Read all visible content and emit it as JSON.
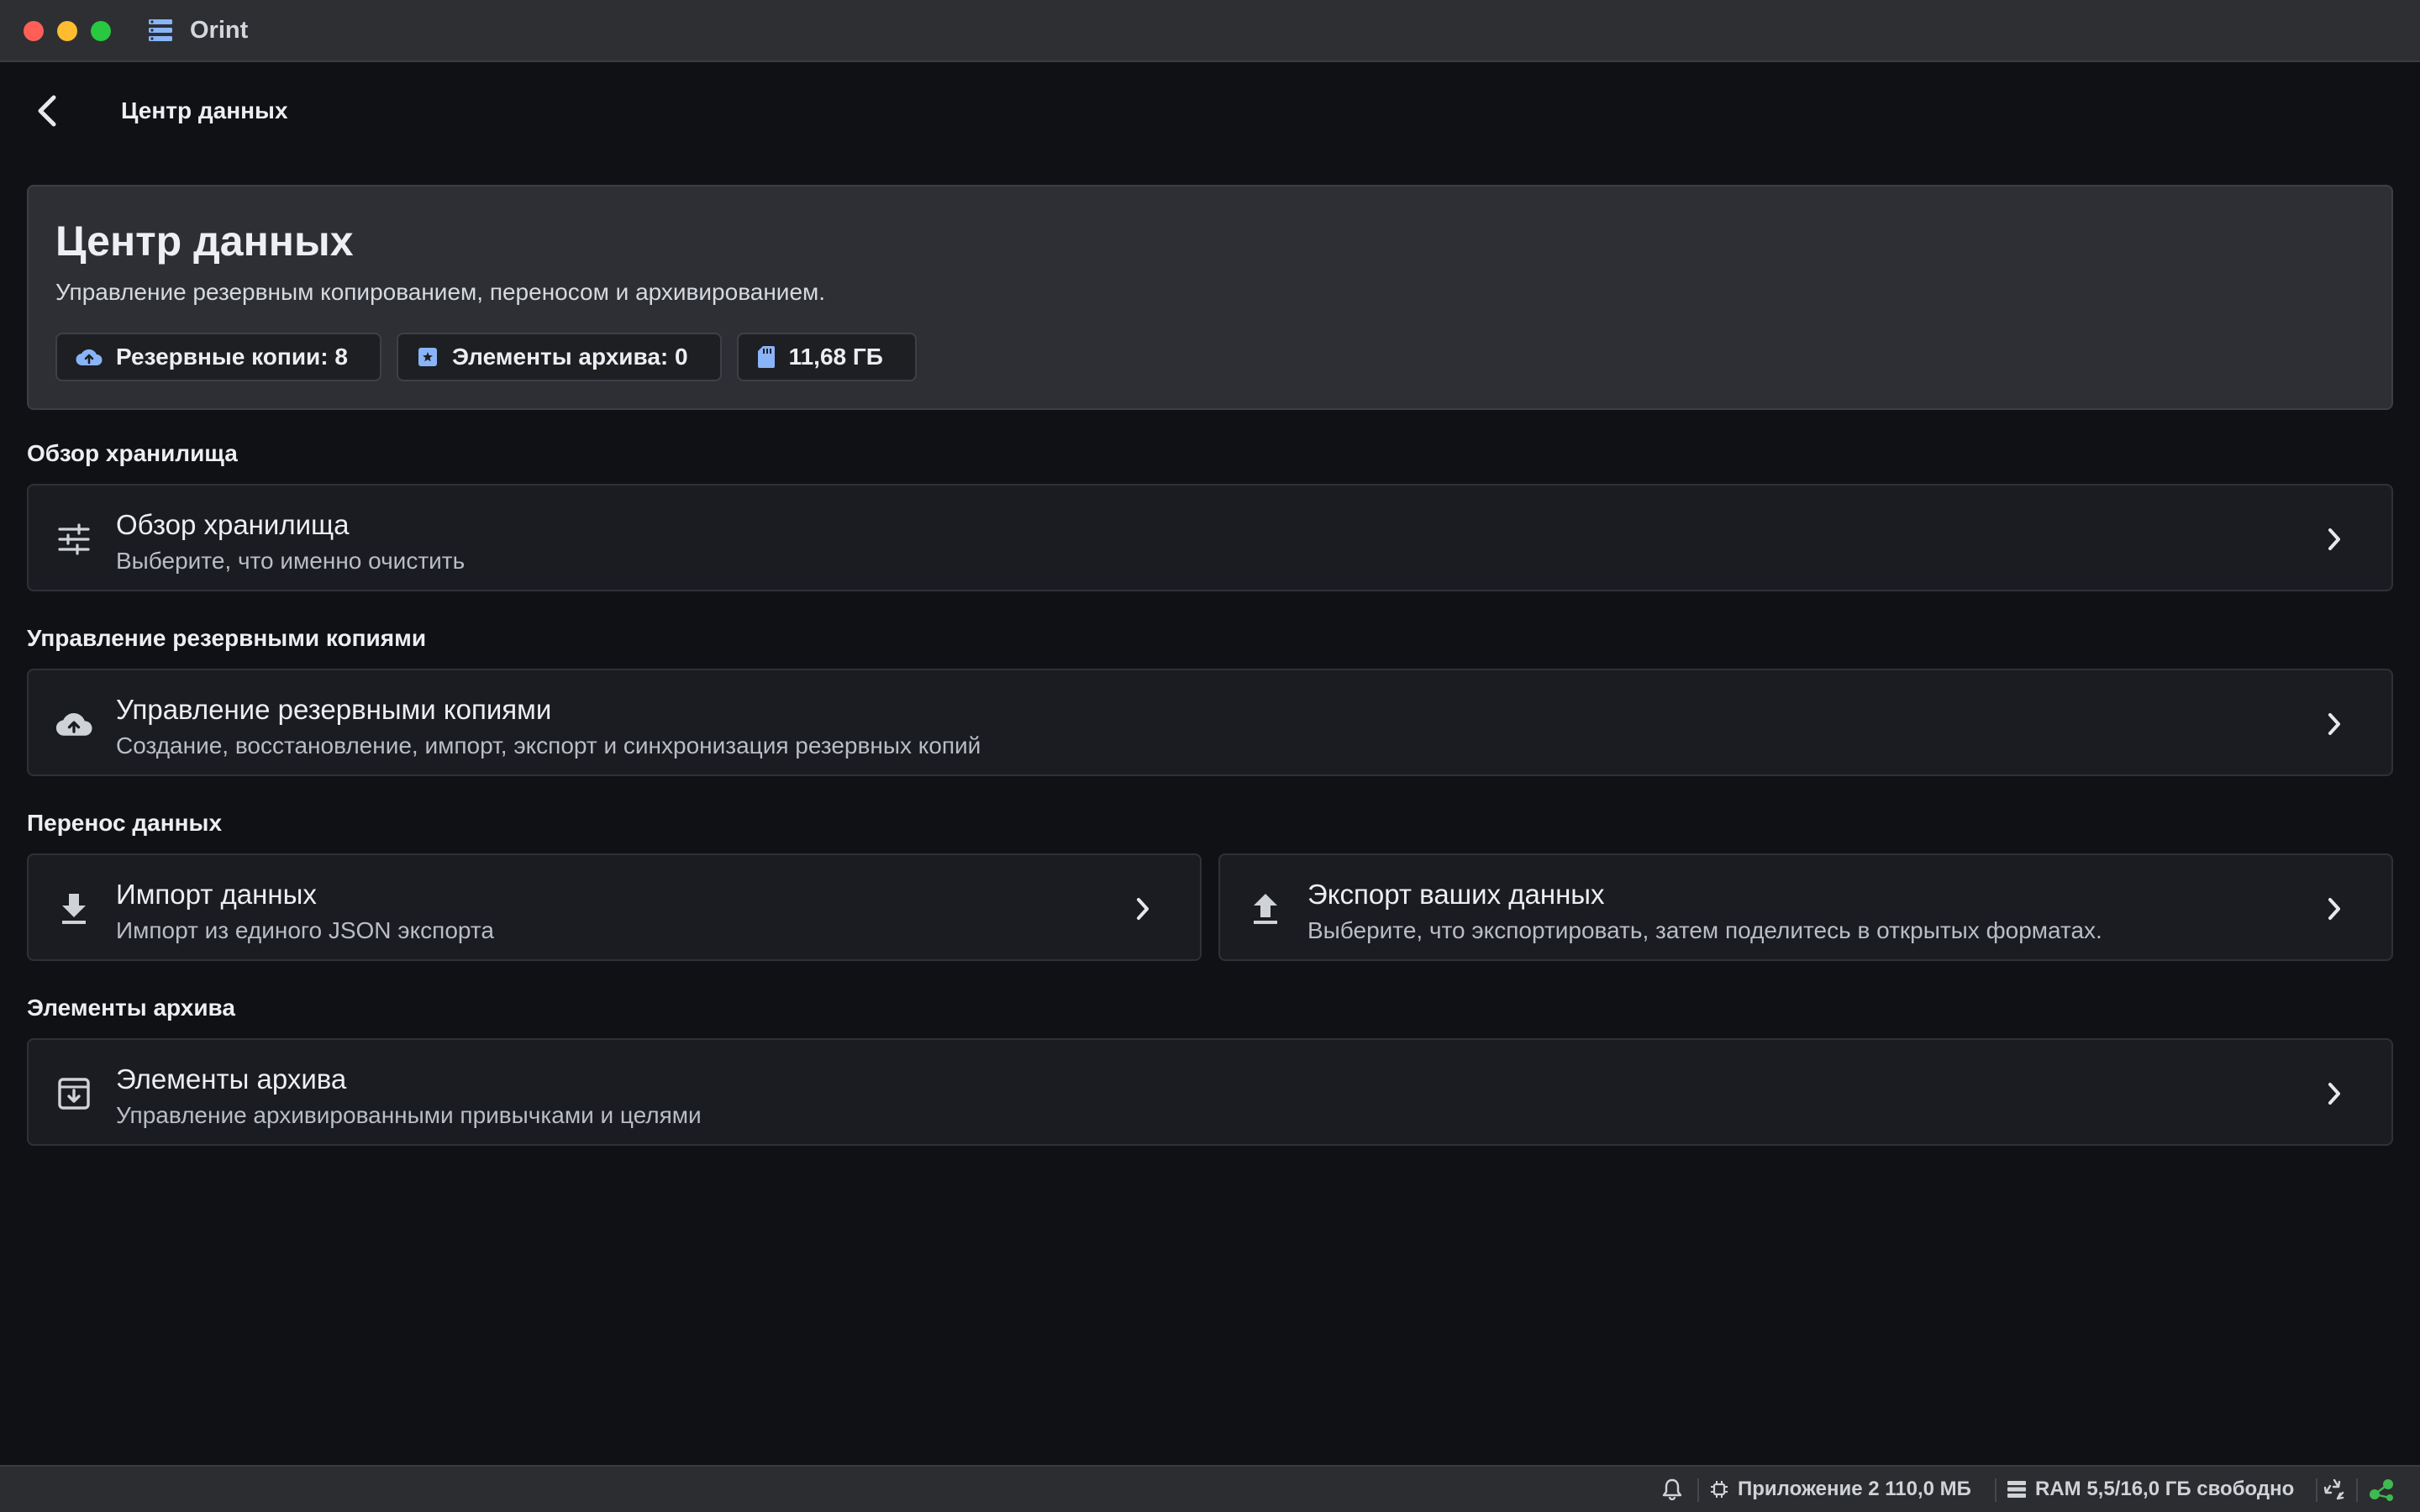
{
  "window": {
    "app_title": "Orint"
  },
  "header": {
    "title": "Центр данных"
  },
  "hero": {
    "title": "Центр данных",
    "subtitle": "Управление резервным копированием, переносом и архивированием.",
    "chips": [
      {
        "icon": "cloud-upload-icon",
        "label": "Резервные копии: 8"
      },
      {
        "icon": "archive-box-icon",
        "label": "Элементы архива: 0"
      },
      {
        "icon": "sd-card-icon",
        "label": "11,68 ГБ"
      }
    ]
  },
  "sections": {
    "storage": {
      "label": "Обзор хранилища",
      "card": {
        "icon": "tune-sliders-icon",
        "title": "Обзор хранилища",
        "description": "Выберите, что именно очистить"
      }
    },
    "backups": {
      "label": "Управление резервными копиями",
      "card": {
        "icon": "cloud-upload-icon",
        "title": "Управление резервными копиями",
        "description": "Создание, восстановление, импорт, экспорт и синхронизация резервных копий"
      }
    },
    "transfer": {
      "label": "Перенос данных",
      "import_card": {
        "icon": "download-icon",
        "title": "Импорт данных",
        "description": "Импорт из единого JSON экспорта"
      },
      "export_card": {
        "icon": "upload-icon",
        "title": "Экспорт ваших данных",
        "description": "Выберите, что экспортировать, затем поделитесь в открытых форматах."
      }
    },
    "archive": {
      "label": "Элементы архива",
      "card": {
        "icon": "archive-icon",
        "title": "Элементы архива",
        "description": "Управление архивированными привычками и целями"
      }
    }
  },
  "statusbar": {
    "app_memory": "Приложение 2 110,0 МБ",
    "ram": "RAM 5,5/16,0 ГБ свободно"
  },
  "colors": {
    "background": "#0f1115",
    "card": "#1a1c21",
    "hero": "#2d2f34",
    "accent_blue": "#8ab4f8",
    "status_green": "#3fb950"
  }
}
